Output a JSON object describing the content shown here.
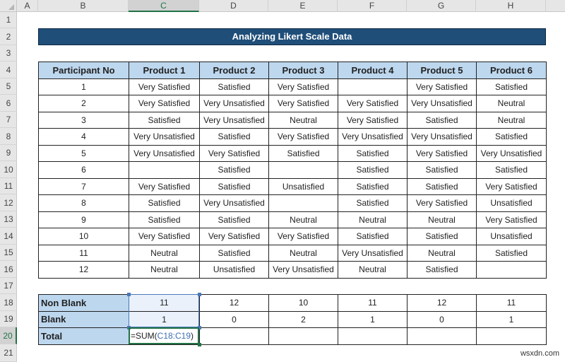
{
  "sheet": {
    "columns": [
      "A",
      "B",
      "C",
      "D",
      "E",
      "F",
      "G",
      "H"
    ],
    "selected_column": "C",
    "rows": [
      "1",
      "2",
      "3",
      "4",
      "5",
      "6",
      "7",
      "8",
      "9",
      "10",
      "11",
      "12",
      "13",
      "14",
      "15",
      "16",
      "17",
      "18",
      "19",
      "20",
      "21"
    ],
    "selected_row": "20"
  },
  "title": "Analyzing Likert Scale Data",
  "main_table": {
    "headers": [
      "Participant No",
      "Product 1",
      "Product 2",
      "Product 3",
      "Product 4",
      "Product 5",
      "Product 6"
    ],
    "rows": [
      [
        "1",
        "Very Satisfied",
        "Satisfied",
        "Very Satisfied",
        "",
        "Very Satisfied",
        "Satisfied"
      ],
      [
        "2",
        "Very Satisfied",
        "Very Unsatisfied",
        "Very Satisfied",
        "Very Satisfied",
        "Very Unsatisfied",
        "Neutral"
      ],
      [
        "3",
        "Satisfied",
        "Very Unsatisfied",
        "Neutral",
        "Very Satisfied",
        "Satisfied",
        "Neutral"
      ],
      [
        "4",
        "Very Unsatisfied",
        "Satisfied",
        "Very Satisfied",
        "Very Unsatisfied",
        "Very Unsatisfied",
        "Satisfied"
      ],
      [
        "5",
        "Very Unsatisfied",
        "Very Satisfied",
        "Satisfied",
        "Satisfied",
        "Very Satisfied",
        "Very Unsatisfied"
      ],
      [
        "6",
        "",
        "Satisfied",
        "",
        "Satisfied",
        "Satisfied",
        "Satisfied"
      ],
      [
        "7",
        "Very Satisfied",
        "Satisfied",
        "Unsatisfied",
        "Satisfied",
        "Satisfied",
        "Very Satisfied"
      ],
      [
        "8",
        "Satisfied",
        "Very Unsatisfied",
        "",
        "Satisfied",
        "Very Satisfied",
        "Unsatisfied"
      ],
      [
        "9",
        "Satisfied",
        "Satisfied",
        "Neutral",
        "Neutral",
        "Neutral",
        "Very Satisfied"
      ],
      [
        "10",
        "Very Satisfied",
        "Very Satisfied",
        "Very Satisfied",
        "Satisfied",
        "Satisfied",
        "Unsatisfied"
      ],
      [
        "11",
        "Neutral",
        "Satisfied",
        "Neutral",
        "Very Unsatisfied",
        "Neutral",
        "Satisfied"
      ],
      [
        "12",
        "Neutral",
        "Unsatisfied",
        "Very Unsatisfied",
        "Neutral",
        "Satisfied",
        ""
      ]
    ]
  },
  "summary": {
    "rows": [
      {
        "label": "Non Blank",
        "values": [
          "11",
          "12",
          "10",
          "11",
          "12",
          "11"
        ]
      },
      {
        "label": "Blank",
        "values": [
          "1",
          "0",
          "2",
          "1",
          "0",
          "1"
        ]
      },
      {
        "label": "Total",
        "values": [
          "",
          "",
          "",
          "",
          "",
          ""
        ]
      }
    ],
    "formula_prefix": "=SUM(",
    "formula_ref": "C18:C19",
    "formula_suffix": ")"
  },
  "watermark": "wsxdn.com"
}
